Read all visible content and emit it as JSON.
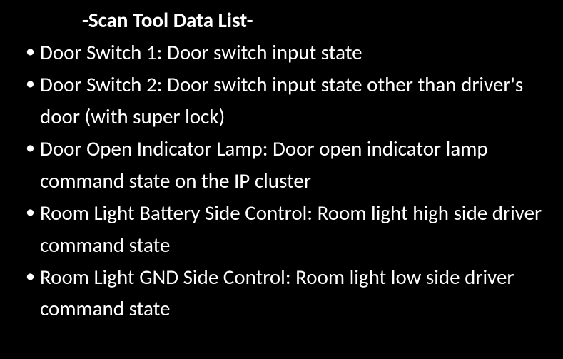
{
  "title": "-Scan Tool Data List-",
  "items": [
    "Door Switch 1: Door switch input state",
    "Door Switch 2: Door switch input state other than driver's door (with super lock)",
    "Door Open Indicator Lamp: Door open indicator lamp command state on the IP cluster",
    "Room Light Battery Side Control: Room light high side driver command state",
    "Room Light GND Side Control: Room light low side driver command state"
  ]
}
